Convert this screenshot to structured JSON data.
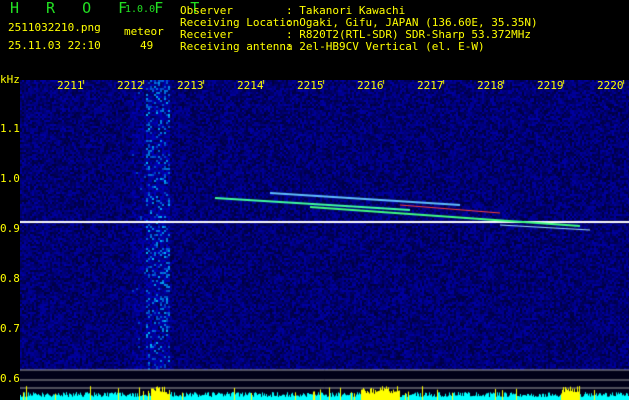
{
  "app": {
    "name": "H R O F F T",
    "version": "1.0.0"
  },
  "file": {
    "name": "2511032210.png",
    "datetime": "25.11.03 22:10"
  },
  "meteor": {
    "label": "meteor",
    "count": "49"
  },
  "info": [
    {
      "label": "Observer",
      "value": ": Takanori Kawachi"
    },
    {
      "label": "Receiving Location",
      "value": ": Ogaki, Gifu, JAPAN (136.60E, 35.35N)"
    },
    {
      "label": "Receiver",
      "value": ": R820T2(RTL-SDR) SDR-Sharp 53.372MHz"
    },
    {
      "label": "Receiving antenna",
      "value": ": 2el-HB9CV Vertical (el. E-W)"
    }
  ],
  "axis": {
    "y_unit": "kHz",
    "y_ticks": [
      "1.1",
      "1.0",
      "0.9",
      "0.8",
      "0.7",
      "0.6"
    ],
    "x_ticks": [
      "2211",
      "2212",
      "2213",
      "2214",
      "2215",
      "2216",
      "2217",
      "2218",
      "2219",
      "2220"
    ]
  },
  "colors": {
    "noise": "#1010a0",
    "carrier": "#ffffff",
    "level_bar": "#00ffff",
    "level_peak": "#ffff00"
  }
}
